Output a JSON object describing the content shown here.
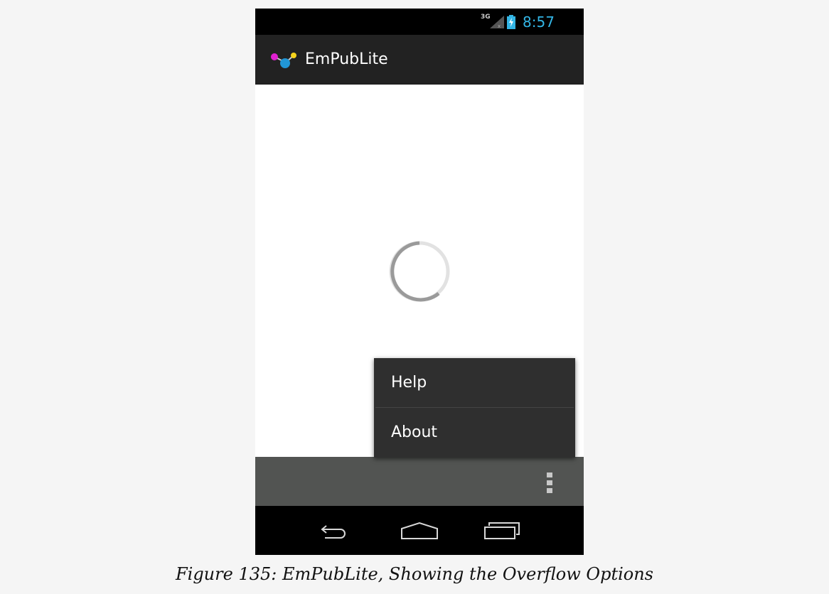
{
  "status_bar": {
    "network": "3G",
    "time": "8:57",
    "time_color": "#33b5e5"
  },
  "action_bar": {
    "title": "EmPubLite",
    "icon": "app-logo-icon"
  },
  "content": {
    "loading_indicator": "spinner"
  },
  "overflow_menu": {
    "items": [
      {
        "label": "Help"
      },
      {
        "label": "About"
      }
    ]
  },
  "bottom_bar": {
    "overflow_icon": "overflow-dots-icon"
  },
  "nav_bar": {
    "buttons": [
      "back-icon",
      "home-icon",
      "recents-icon"
    ]
  },
  "caption": "Figure 135: EmPubLite, Showing the Overflow Options"
}
